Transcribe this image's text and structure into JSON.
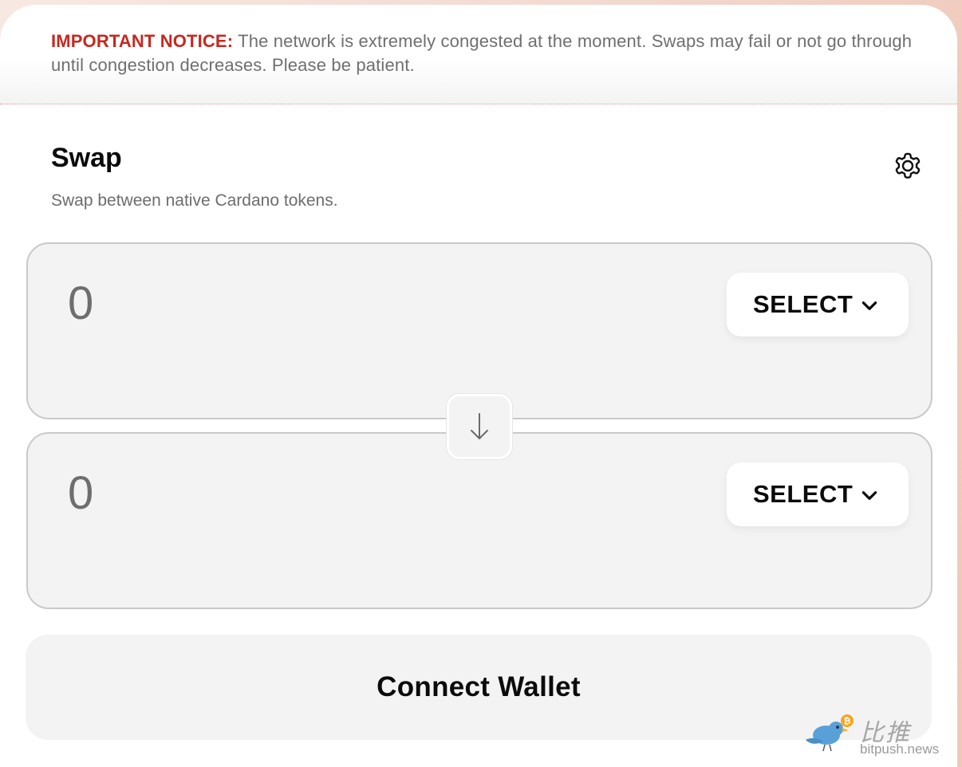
{
  "notice": {
    "label": "IMPORTANT NOTICE:",
    "message": " The network is extremely congested at the moment. Swaps may fail or not go through until congestion decreases. Please be patient."
  },
  "swap": {
    "title": "Swap",
    "subtitle": "Swap between native Cardano tokens.",
    "settings_icon": "gear-icon",
    "from": {
      "amount_placeholder": "0",
      "select_label": "SELECT",
      "select_icon": "chevron-down-icon"
    },
    "to": {
      "amount_placeholder": "0",
      "select_label": "SELECT",
      "select_icon": "chevron-down-icon"
    },
    "flip_icon": "arrow-down-icon",
    "connect_label": "Connect Wallet"
  },
  "watermark": {
    "chinese": "比推",
    "domain": "bitpush.news",
    "logo_icon": "bird-icon"
  },
  "colors": {
    "notice_accent": "#c6281f",
    "panel_bg": "#f3f3f3",
    "panel_border": "#c9c9c9",
    "watermark_bird": "#5aa0d8",
    "watermark_coin": "#f5a623"
  }
}
